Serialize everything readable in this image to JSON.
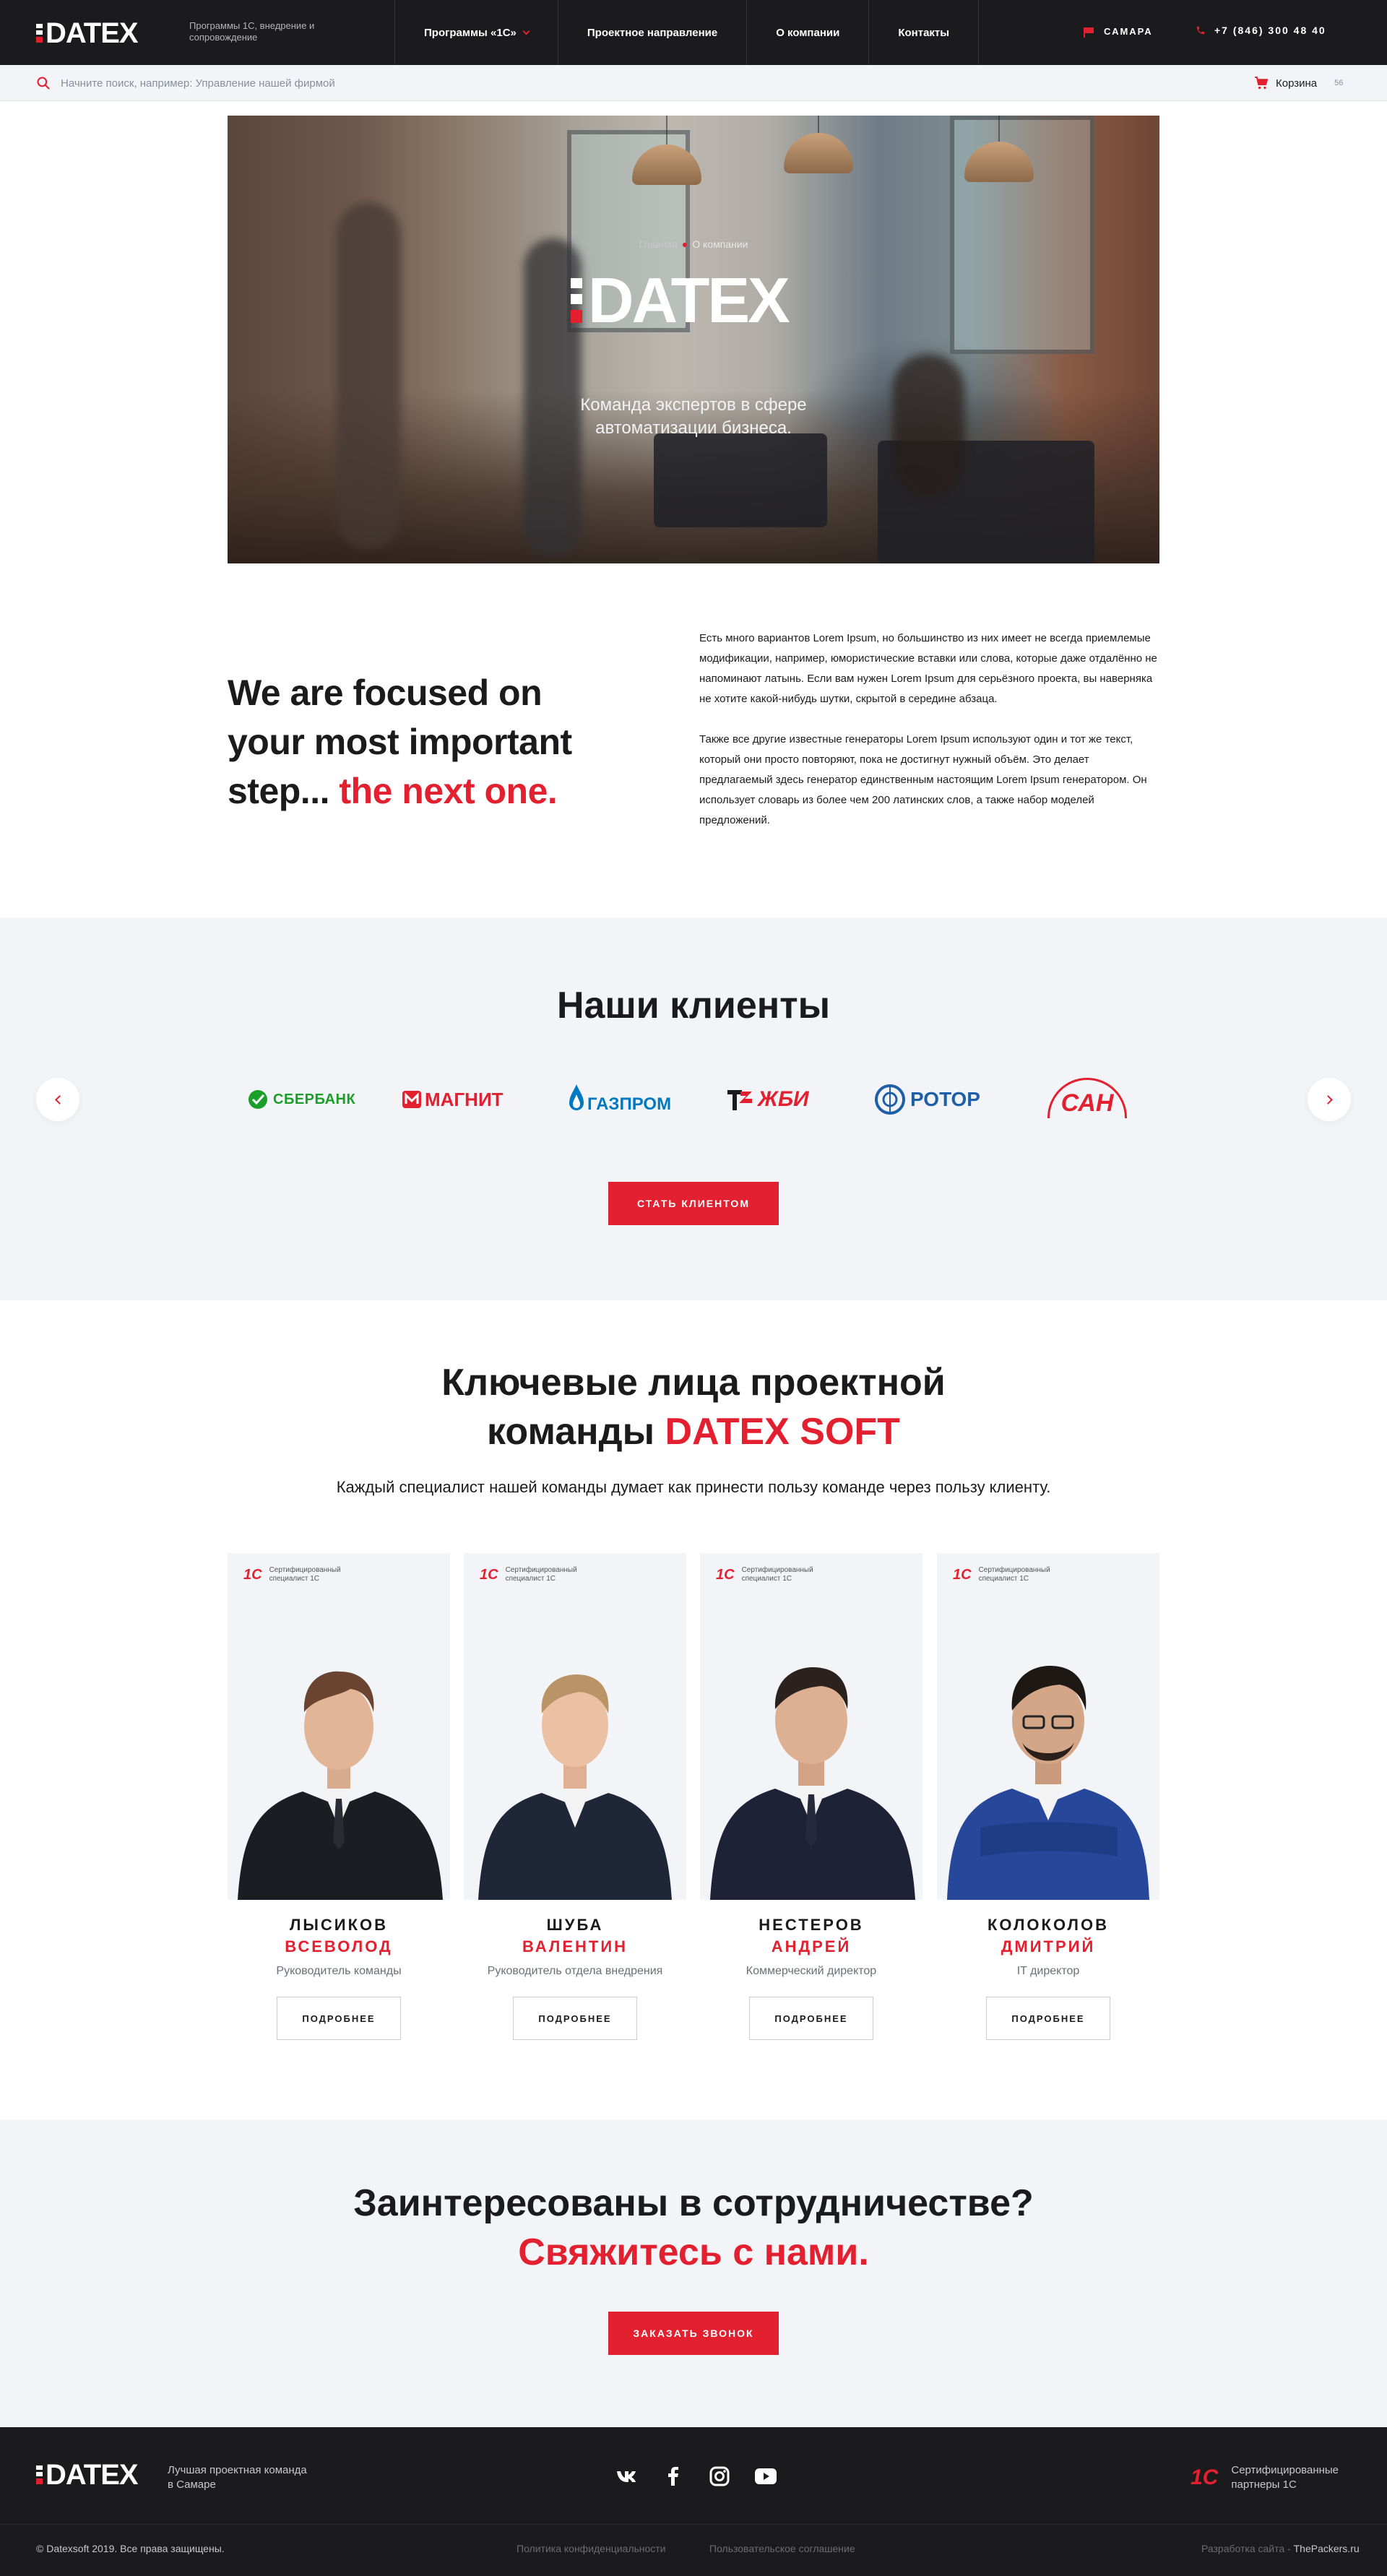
{
  "header": {
    "logo_text": "DATEX",
    "tagline": "Программы 1С, внедрение и сопровождение",
    "nav": [
      {
        "label": "Программы «1С»"
      },
      {
        "label": "Проектное направление"
      },
      {
        "label": "О компании"
      },
      {
        "label": "Контакты"
      }
    ],
    "city": "САМАРА",
    "phone": "+7 (846) 300 48 40"
  },
  "search": {
    "placeholder": "Начните поиск, например: Управление нашей фирмой",
    "cart_label": "Корзина",
    "cart_count": "56"
  },
  "hero": {
    "breadcrumb_home": "Главная",
    "breadcrumb_current": "О компании",
    "logo_text": "DATEX",
    "subtitle_line1": "Команда экспертов в сфере",
    "subtitle_line2": "автоматизации бизнеса."
  },
  "about": {
    "heading_line1": "We are focused on",
    "heading_line2": "your most important",
    "heading_line3_start": "step...",
    "heading_line3_accent": "the next one.",
    "paragraph1": "Есть много вариантов Lorem Ipsum, но большинство из них имеет не всегда приемлемые модификации, например, юмористические вставки или слова, которые даже отдалённо не напоминают латынь. Если вам нужен Lorem Ipsum для серьёзного проекта, вы наверняка не хотите какой-нибудь шутки, скрытой в середине абзаца.",
    "paragraph2": "Также все другие известные генераторы Lorem Ipsum используют один и тот же текст, который они просто повторяют, пока не достигнут нужный объём. Это делает предлагаемый здесь генератор единственным настоящим Lorem Ipsum генератором. Он использует словарь из более чем 200 латинских слов, а также набор моделей предложений."
  },
  "clients": {
    "heading": "Наши клиенты",
    "logos": [
      {
        "name": "СБЕРБАНК",
        "color": "#1a9f29"
      },
      {
        "name": "МАГНИТ",
        "color": "#e3202f"
      },
      {
        "name": "ГАЗПРОМ",
        "color": "#0079c2"
      },
      {
        "name": "ЖБИ",
        "color": "#e3202f"
      },
      {
        "name": "РОТОР",
        "color": "#1f5fa8"
      },
      {
        "name": "САН",
        "color": "#e3202f"
      }
    ],
    "button_label": "СТАТЬ КЛИЕНТОМ"
  },
  "team": {
    "heading_line1": "Ключевые лица проектной",
    "heading_line2_start": "команды",
    "heading_line2_accent": "DATEX SOFT",
    "subtitle": "Каждый специалист нашей команды думает как принести пользу команде через пользу клиенту.",
    "cert_label": "1С",
    "cert_text": "Сертифицированный специалист 1С",
    "more_label": "ПОДРОБНЕЕ",
    "members": [
      {
        "surname": "ЛЫСИКОВ",
        "name": "ВСЕВОЛОД",
        "role": "Руководитель команды"
      },
      {
        "surname": "ШУБА",
        "name": "ВАЛЕНТИН",
        "role": "Руководитель отдела внедрения"
      },
      {
        "surname": "НЕСТЕРОВ",
        "name": "АНДРЕЙ",
        "role": "Коммерческий директор"
      },
      {
        "surname": "КОЛОКОЛОВ",
        "name": "ДМИТРИЙ",
        "role": "IT директор"
      }
    ]
  },
  "cta": {
    "heading": "Заинтересованы в сотрудничестве?",
    "heading_accent": "Свяжитесь с нами.",
    "button_label": "ЗАКАЗАТЬ ЗВОНОК"
  },
  "footer": {
    "logo_text": "DATEX",
    "tagline": "Лучшая проектная команда в Самаре",
    "socials": [
      "vk-icon",
      "facebook-icon",
      "instagram-icon",
      "youtube-icon"
    ],
    "partner_label": "1С",
    "partner_text": "Сертифицированные партнеры 1С",
    "copyright": "© Datexsoft 2019. Все права защищены.",
    "privacy": "Политика конфиденциальности",
    "agreement": "Пользовательское соглашение",
    "developer_prefix": "Разработка сайта -",
    "developer_name": "ThePackers.ru"
  },
  "colors": {
    "accent": "#e3202f",
    "dark": "#1b1b1d",
    "light_bg": "#f2f4f8"
  }
}
